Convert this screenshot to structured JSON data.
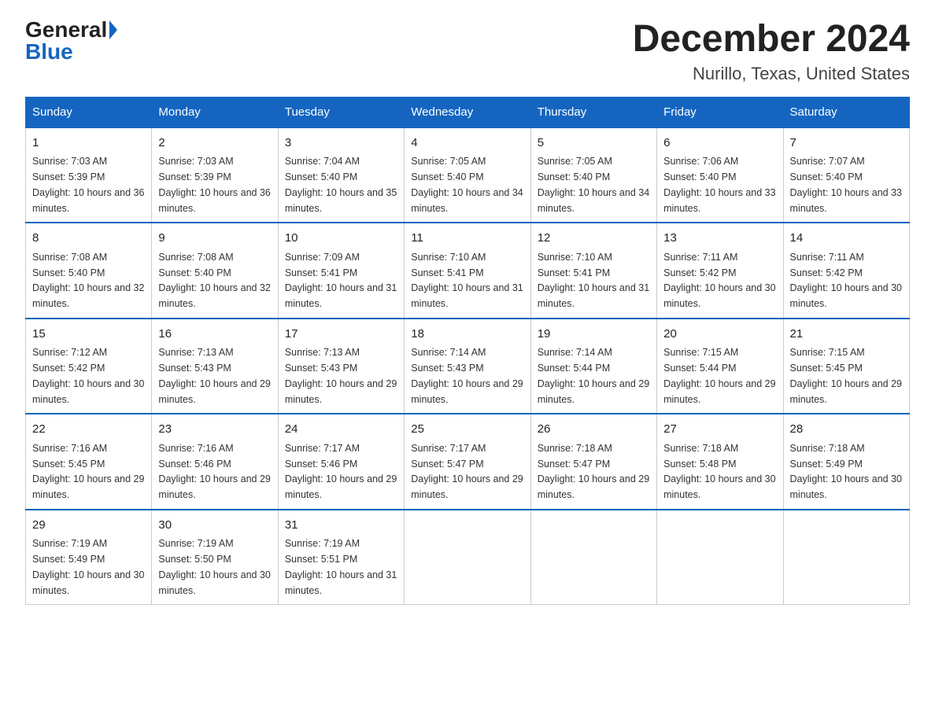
{
  "header": {
    "logo_general": "General",
    "logo_blue": "Blue",
    "month_title": "December 2024",
    "location": "Nurillo, Texas, United States"
  },
  "weekdays": [
    "Sunday",
    "Monday",
    "Tuesday",
    "Wednesday",
    "Thursday",
    "Friday",
    "Saturday"
  ],
  "weeks": [
    [
      {
        "day": "1",
        "sunrise": "7:03 AM",
        "sunset": "5:39 PM",
        "daylight": "10 hours and 36 minutes."
      },
      {
        "day": "2",
        "sunrise": "7:03 AM",
        "sunset": "5:39 PM",
        "daylight": "10 hours and 36 minutes."
      },
      {
        "day": "3",
        "sunrise": "7:04 AM",
        "sunset": "5:40 PM",
        "daylight": "10 hours and 35 minutes."
      },
      {
        "day": "4",
        "sunrise": "7:05 AM",
        "sunset": "5:40 PM",
        "daylight": "10 hours and 34 minutes."
      },
      {
        "day": "5",
        "sunrise": "7:05 AM",
        "sunset": "5:40 PM",
        "daylight": "10 hours and 34 minutes."
      },
      {
        "day": "6",
        "sunrise": "7:06 AM",
        "sunset": "5:40 PM",
        "daylight": "10 hours and 33 minutes."
      },
      {
        "day": "7",
        "sunrise": "7:07 AM",
        "sunset": "5:40 PM",
        "daylight": "10 hours and 33 minutes."
      }
    ],
    [
      {
        "day": "8",
        "sunrise": "7:08 AM",
        "sunset": "5:40 PM",
        "daylight": "10 hours and 32 minutes."
      },
      {
        "day": "9",
        "sunrise": "7:08 AM",
        "sunset": "5:40 PM",
        "daylight": "10 hours and 32 minutes."
      },
      {
        "day": "10",
        "sunrise": "7:09 AM",
        "sunset": "5:41 PM",
        "daylight": "10 hours and 31 minutes."
      },
      {
        "day": "11",
        "sunrise": "7:10 AM",
        "sunset": "5:41 PM",
        "daylight": "10 hours and 31 minutes."
      },
      {
        "day": "12",
        "sunrise": "7:10 AM",
        "sunset": "5:41 PM",
        "daylight": "10 hours and 31 minutes."
      },
      {
        "day": "13",
        "sunrise": "7:11 AM",
        "sunset": "5:42 PM",
        "daylight": "10 hours and 30 minutes."
      },
      {
        "day": "14",
        "sunrise": "7:11 AM",
        "sunset": "5:42 PM",
        "daylight": "10 hours and 30 minutes."
      }
    ],
    [
      {
        "day": "15",
        "sunrise": "7:12 AM",
        "sunset": "5:42 PM",
        "daylight": "10 hours and 30 minutes."
      },
      {
        "day": "16",
        "sunrise": "7:13 AM",
        "sunset": "5:43 PM",
        "daylight": "10 hours and 29 minutes."
      },
      {
        "day": "17",
        "sunrise": "7:13 AM",
        "sunset": "5:43 PM",
        "daylight": "10 hours and 29 minutes."
      },
      {
        "day": "18",
        "sunrise": "7:14 AM",
        "sunset": "5:43 PM",
        "daylight": "10 hours and 29 minutes."
      },
      {
        "day": "19",
        "sunrise": "7:14 AM",
        "sunset": "5:44 PM",
        "daylight": "10 hours and 29 minutes."
      },
      {
        "day": "20",
        "sunrise": "7:15 AM",
        "sunset": "5:44 PM",
        "daylight": "10 hours and 29 minutes."
      },
      {
        "day": "21",
        "sunrise": "7:15 AM",
        "sunset": "5:45 PM",
        "daylight": "10 hours and 29 minutes."
      }
    ],
    [
      {
        "day": "22",
        "sunrise": "7:16 AM",
        "sunset": "5:45 PM",
        "daylight": "10 hours and 29 minutes."
      },
      {
        "day": "23",
        "sunrise": "7:16 AM",
        "sunset": "5:46 PM",
        "daylight": "10 hours and 29 minutes."
      },
      {
        "day": "24",
        "sunrise": "7:17 AM",
        "sunset": "5:46 PM",
        "daylight": "10 hours and 29 minutes."
      },
      {
        "day": "25",
        "sunrise": "7:17 AM",
        "sunset": "5:47 PM",
        "daylight": "10 hours and 29 minutes."
      },
      {
        "day": "26",
        "sunrise": "7:18 AM",
        "sunset": "5:47 PM",
        "daylight": "10 hours and 29 minutes."
      },
      {
        "day": "27",
        "sunrise": "7:18 AM",
        "sunset": "5:48 PM",
        "daylight": "10 hours and 30 minutes."
      },
      {
        "day": "28",
        "sunrise": "7:18 AM",
        "sunset": "5:49 PM",
        "daylight": "10 hours and 30 minutes."
      }
    ],
    [
      {
        "day": "29",
        "sunrise": "7:19 AM",
        "sunset": "5:49 PM",
        "daylight": "10 hours and 30 minutes."
      },
      {
        "day": "30",
        "sunrise": "7:19 AM",
        "sunset": "5:50 PM",
        "daylight": "10 hours and 30 minutes."
      },
      {
        "day": "31",
        "sunrise": "7:19 AM",
        "sunset": "5:51 PM",
        "daylight": "10 hours and 31 minutes."
      },
      null,
      null,
      null,
      null
    ]
  ]
}
